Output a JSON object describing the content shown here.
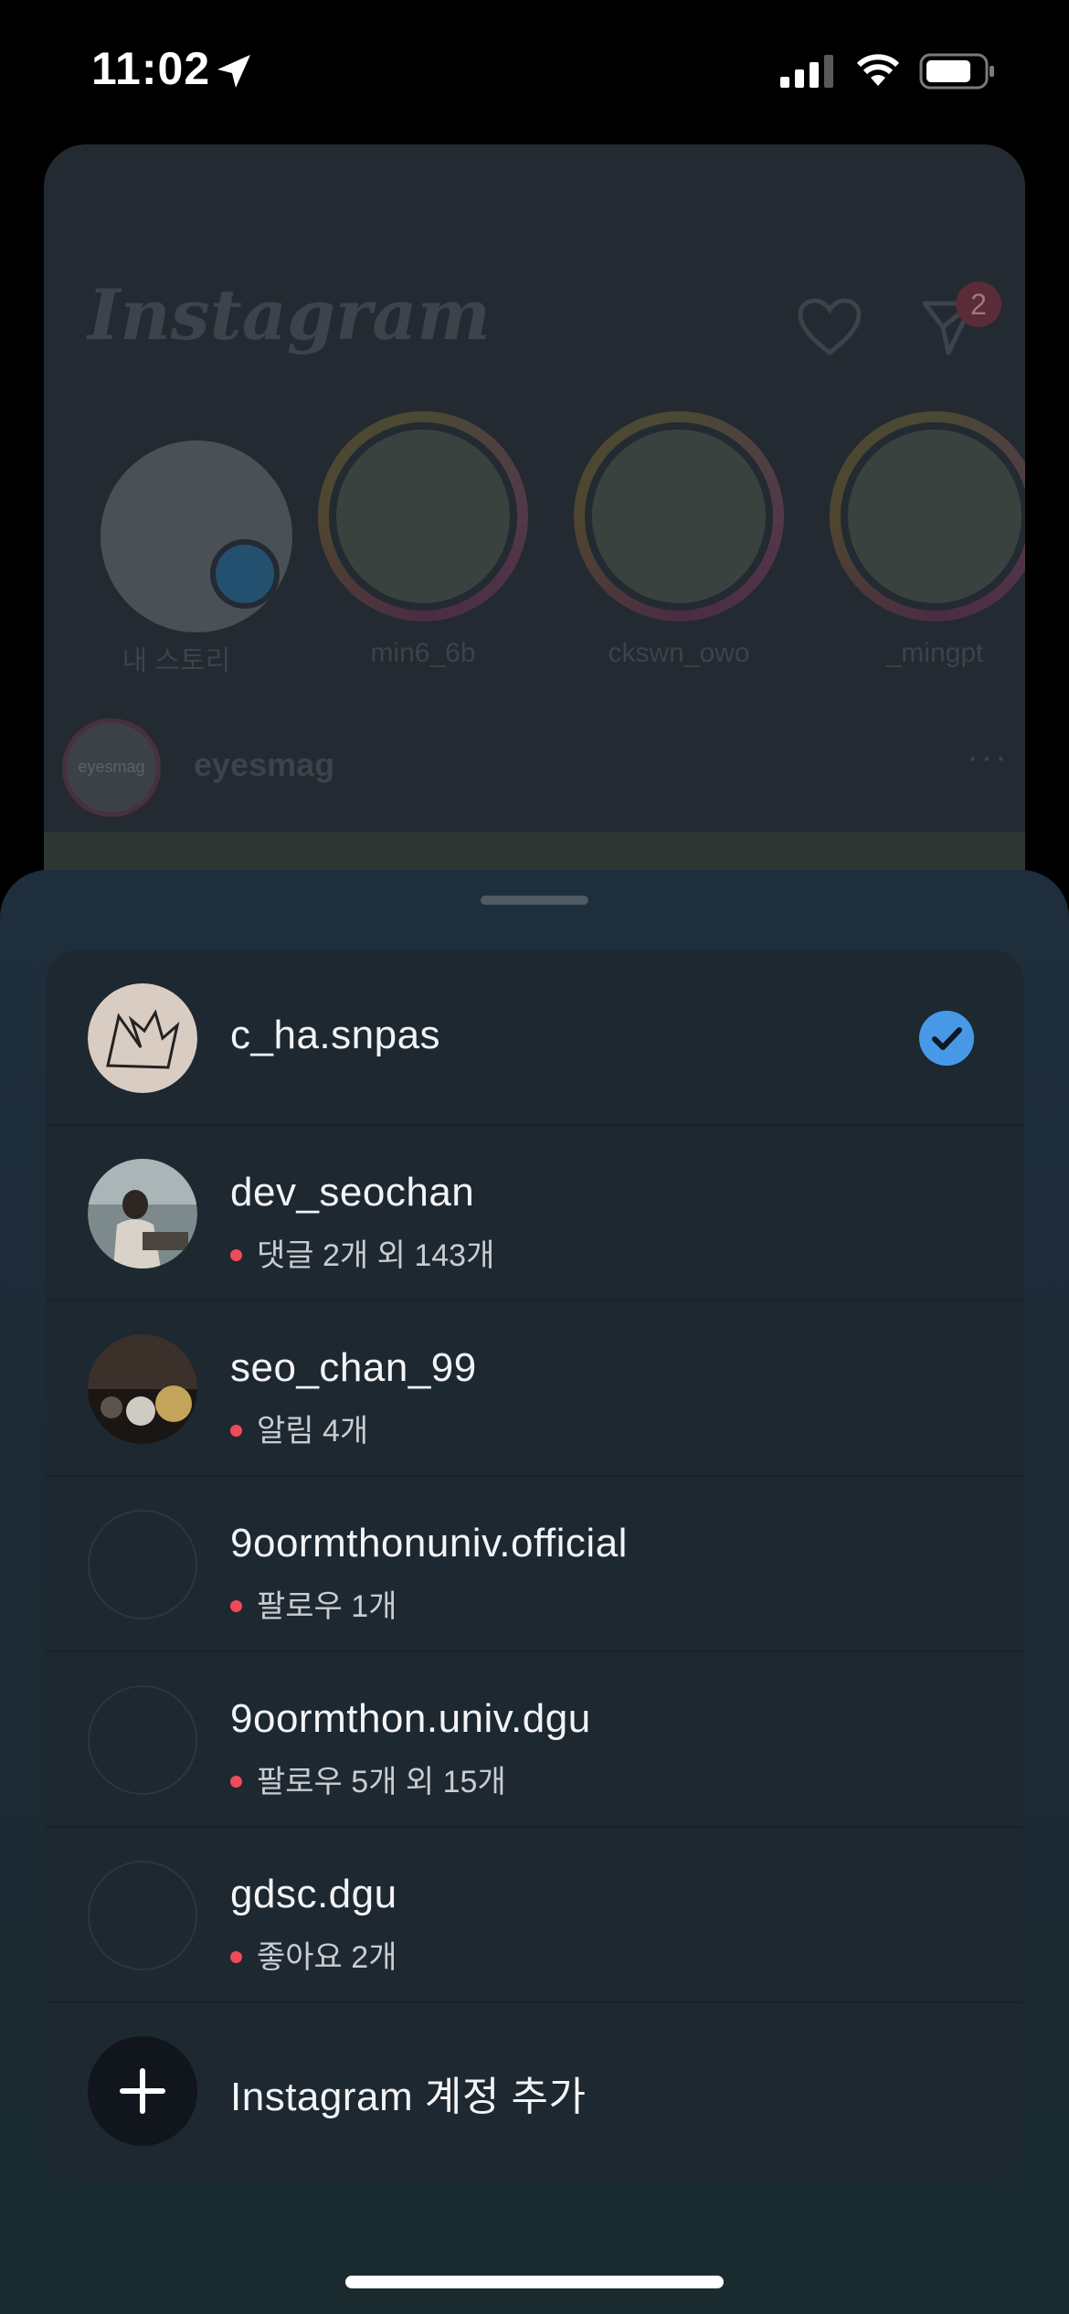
{
  "status_bar": {
    "time": "11:02",
    "icons": [
      "location-arrow-icon",
      "cellular-signal-icon",
      "wifi-icon",
      "battery-icon"
    ]
  },
  "feed": {
    "logo": "Instagram",
    "notification_count": "2",
    "stories": [
      {
        "name": "내 스토리"
      },
      {
        "name": "min6_6b"
      },
      {
        "name": "ckswn_owo"
      },
      {
        "name": "_mingpt"
      }
    ],
    "post": {
      "avatar_text": "eyesmag",
      "username": "eyesmag",
      "more": "···"
    }
  },
  "account_switcher": {
    "accounts": [
      {
        "username": "c_ha.snpas",
        "activity": "",
        "selected": true
      },
      {
        "username": "dev_seochan",
        "activity": "댓글 2개 외 143개"
      },
      {
        "username": "seo_chan_99",
        "activity": "알림 4개"
      },
      {
        "username": "9oormthonuniv.official",
        "activity": "팔로우 1개"
      },
      {
        "username": "9oormthon.univ.dgu",
        "activity": "팔로우 5개 외 15개"
      },
      {
        "username": "gdsc.dgu",
        "activity": "좋아요 2개"
      }
    ],
    "add_account_label": "Instagram 계정 추가"
  },
  "colors": {
    "accent_check": "#4799e8",
    "activity_dot": "#ef4a5c",
    "panel": "#1e2830"
  }
}
